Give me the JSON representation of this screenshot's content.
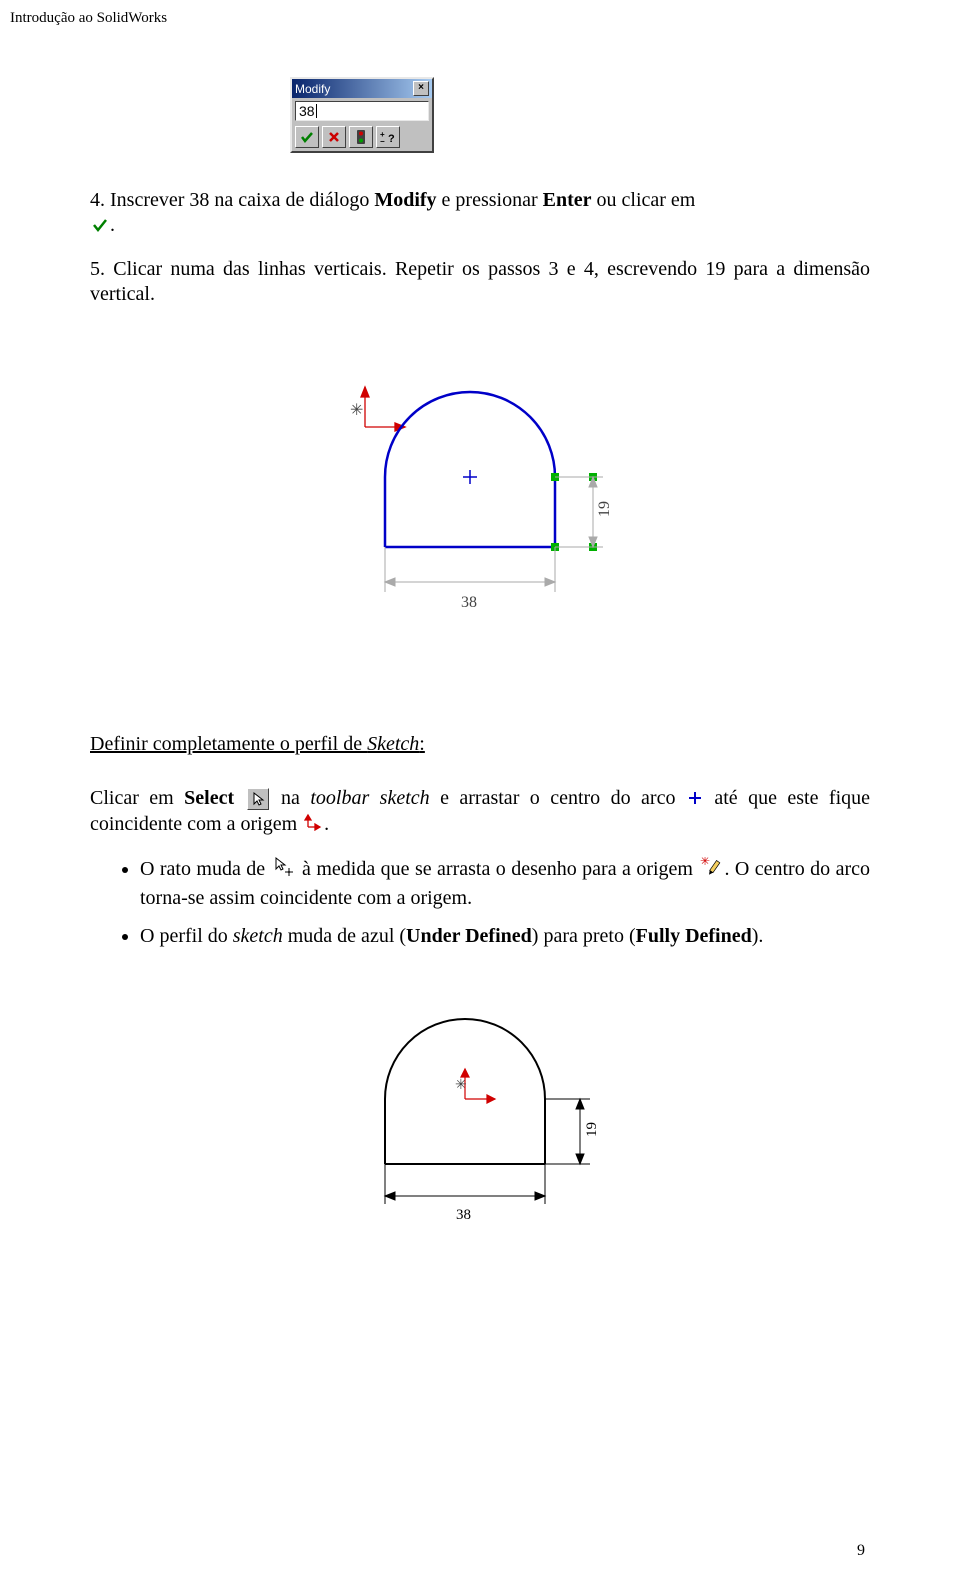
{
  "header": "Introdução ao SolidWorks",
  "modify_dialog": {
    "title": "Modify",
    "value": "38",
    "close_label": "×"
  },
  "step4": {
    "num": "4.",
    "t1": "Inscrever 38 na caixa de diálogo ",
    "mod": "Modify",
    "t2": " e pressionar ",
    "enter": "Enter",
    "t3": " ou clicar em ",
    "t4": "."
  },
  "step5": {
    "num": "5.",
    "t1": "Clicar numa das linhas verticais. Repetir os passos 3 e 4, escrevendo 19 para a dimensão vertical."
  },
  "chart_data": [
    {
      "type": "diagram",
      "name": "sketch-under-defined",
      "dimensions": {
        "width": 38,
        "height_side": 19
      },
      "color": "blue",
      "labels": {
        "bottom": "38",
        "right": "19"
      }
    },
    {
      "type": "diagram",
      "name": "sketch-fully-defined",
      "dimensions": {
        "width": 38,
        "height_side": 19
      },
      "color": "black",
      "labels": {
        "bottom": "38",
        "right": "19"
      }
    }
  ],
  "section_title": {
    "t1": "Definir completamente o perfil de ",
    "sketch": "Sketch",
    "t2": ":"
  },
  "para_select": {
    "t1": "Clicar em ",
    "select": "Select",
    "t2": " na ",
    "toolbar": "toolbar sketch",
    "t3": " e arrastar o centro do arco ",
    "t4": " até que este fique coincidente com a origem ",
    "t5": "."
  },
  "bullets": {
    "b1": {
      "t1": "O rato muda de ",
      "t2": " à medida que se arrasta o desenho para a origem ",
      "t3": ". O centro do arco torna-se assim coincidente com a origem."
    },
    "b2": {
      "t1": "O perfil do ",
      "sketch": "sketch",
      "t2": " muda de azul (",
      "under": "Under Defined",
      "t3": ") para preto (",
      "fully": "Fully Defined",
      "t4": ")."
    }
  },
  "page_number": "9"
}
